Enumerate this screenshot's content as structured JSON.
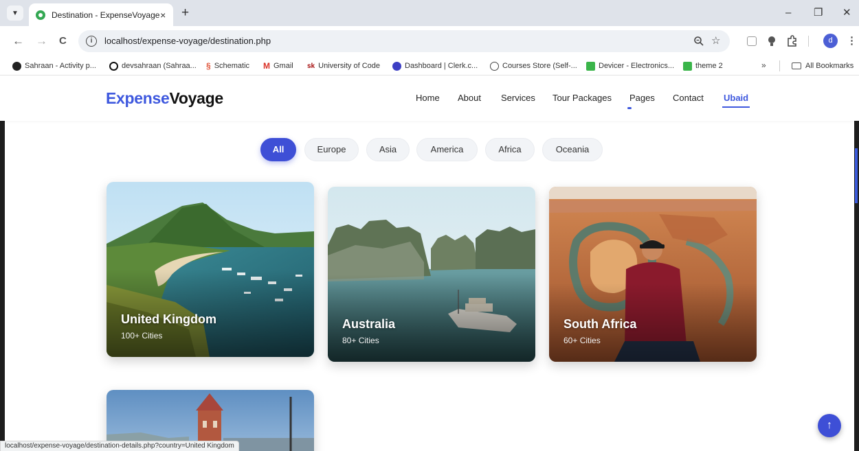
{
  "browser": {
    "tab": {
      "title": "Destination - ExpenseVoyage",
      "close": "×"
    },
    "new_tab": "+",
    "window_controls": {
      "minimize": "–",
      "restore": "❐",
      "close": "✕"
    },
    "nav": {
      "back": "←",
      "forward": "→",
      "reload": "C"
    },
    "url": "localhost/expense-voyage/destination.php",
    "profile_initial": "d",
    "bookmarks": [
      {
        "label": "Sahraan - Activity p...",
        "icon_color": "#222222"
      },
      {
        "label": "devsahraan (Sahraa...",
        "icon_color": "#111111"
      },
      {
        "label": "Schematic",
        "icon_color": "#e0573d"
      },
      {
        "label": "Gmail",
        "icon_color": "#d93025"
      },
      {
        "label": "University of Code",
        "icon_color": "#a50e0e"
      },
      {
        "label": "Dashboard | Clerk.c...",
        "icon_color": "#3d3fc4"
      },
      {
        "label": "Courses Store (Self-...",
        "icon_color": "#444444"
      },
      {
        "label": "Devicer - Electronics...",
        "icon_color": "#3ab54a"
      },
      {
        "label": "theme 2",
        "icon_color": "#3ab54a"
      }
    ],
    "bookmarks_more": "»",
    "all_bookmarks": "All Bookmarks",
    "status_url": "localhost/expense-voyage/destination-details.php?country=United Kingdom"
  },
  "site": {
    "logo_part1": "Expense",
    "logo_part2": "Voyage",
    "menu": [
      "Home",
      "About",
      "Services",
      "Tour Packages",
      "Pages",
      "Contact",
      "Ubaid"
    ],
    "active_menu": "Ubaid",
    "accent_color": "#3e4fd6"
  },
  "filters": [
    "All",
    "Europe",
    "Asia",
    "America",
    "Africa",
    "Oceania"
  ],
  "active_filter": "All",
  "destinations": [
    {
      "name": "United Kingdom",
      "cities": "100+ Cities"
    },
    {
      "name": "Australia",
      "cities": "80+ Cities"
    },
    {
      "name": "South Africa",
      "cities": "60+ Cities"
    }
  ],
  "scroll_top_icon": "↑"
}
